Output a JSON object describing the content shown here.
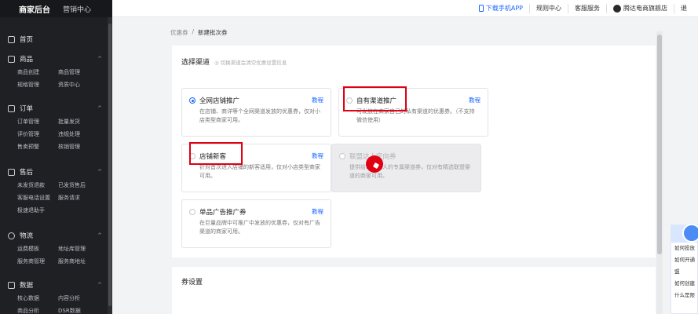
{
  "sidebar": {
    "brand": "商家后台",
    "marketing": "营销中心",
    "home": "首页",
    "sections": [
      {
        "title": "商品",
        "items": [
          "商品创建",
          "商品管理",
          "规格管理",
          "资质中心"
        ]
      },
      {
        "title": "订单",
        "items": [
          "订单管理",
          "批量发货",
          "评价管理",
          "违规处理",
          "售卖预警",
          "核销管理"
        ]
      },
      {
        "title": "售后",
        "items": [
          "未发货退款",
          "已发货售后",
          "客服电话设置",
          "服务请求",
          "极速退助手"
        ]
      },
      {
        "title": "物流",
        "items": [
          "运费模板",
          "地址库管理",
          "服务商管理",
          "服务商地址"
        ]
      },
      {
        "title": "数据",
        "items": [
          "核心数据",
          "内容分析",
          "商品分析",
          "DSR数据"
        ]
      }
    ]
  },
  "topbar": {
    "download": "下载手机APP",
    "rules": "规则中心",
    "service": "客服服务",
    "shop": "腾达电商旗舰店",
    "extra": "退"
  },
  "breadcrumb": {
    "parent": "优惠券",
    "sep": "/",
    "current": "新建批次券"
  },
  "channel": {
    "title": "选择渠道",
    "hint": "◎ 切换渠道会清空优惠设置信息",
    "options": [
      {
        "label": "全网店铺推广",
        "tutorial": "教程",
        "desc": "在店铺、商详等个全网渠道发放的优惠券，仅对小店类型商家可用。"
      },
      {
        "label": "自有渠道推广",
        "tutorial": "教程",
        "desc": "可发放在商家自己的私有渠道的优惠券。（不支持微信使用）"
      },
      {
        "label": "店铺新客",
        "tutorial": "教程",
        "desc": "针对首次进入店铺的新客适用，仅对小店类型商家可用。"
      },
      {
        "label": "联盟达人定向券",
        "tutorial": "",
        "desc": "提供给联盟达人的专属渠道券，仅对有精选联盟渠道的商家可用。"
      },
      {
        "label": "单品广告推广券",
        "tutorial": "教程",
        "desc": "在巨量品牌中可推广中发放的优惠券，仅对有广告渠道的商家可用。"
      }
    ]
  },
  "coupon": {
    "title": "券设置"
  },
  "help": {
    "q1": "如何投放",
    "q2": "如何开通",
    "q2b": "盟",
    "q3": "如何创建",
    "q4": "什么是限"
  }
}
